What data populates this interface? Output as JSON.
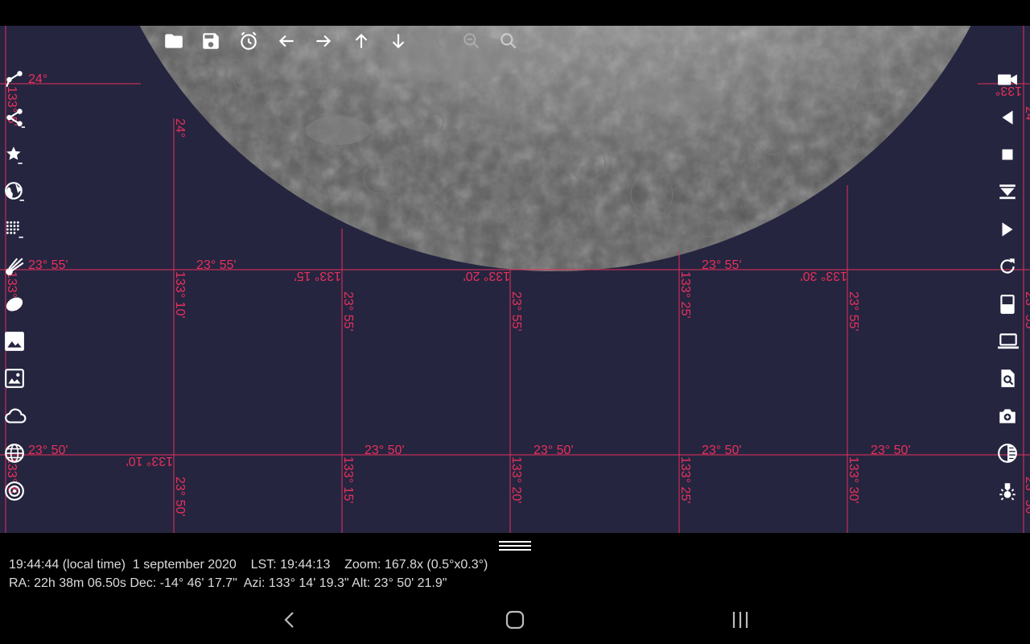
{
  "grid_labels": {
    "dec_24": "24°",
    "dec_2355": "23° 55'",
    "dec_2350": "23° 50'",
    "dec_2355_vertical": "23° 55'",
    "dec_2350_vertical": "23° 50'",
    "azi_13310": "133° 10'",
    "azi_13315": "133° 15'",
    "azi_13320": "133° 20'",
    "azi_13325": "133° 25'",
    "azi_13330": "133° 30'",
    "azi_edge": "133°",
    "azi_edge_v": "133° 5'"
  },
  "top_toolbar": [
    {
      "icon": "folder-icon",
      "label": "Open"
    },
    {
      "icon": "save-icon",
      "label": "Save"
    },
    {
      "icon": "alarm-clock-icon",
      "label": "Time"
    },
    {
      "icon": "arrow-left-icon",
      "label": "Left"
    },
    {
      "icon": "arrow-right-icon",
      "label": "Right"
    },
    {
      "icon": "arrow-up-icon",
      "label": "Up"
    },
    {
      "icon": "arrow-down-icon",
      "label": "Down"
    },
    {
      "icon": "zoom-in-icon",
      "label": "Zoom in"
    },
    {
      "icon": "zoom-out-icon",
      "label": "Zoom out"
    },
    {
      "icon": "zoom-icon",
      "label": "Zoom"
    }
  ],
  "left_toolbar": [
    "share-constellation-lines-icon",
    "share-constellation-icon",
    "star-icon",
    "globe-grid-icon",
    "dots-grid-icon",
    "comet-icon",
    "asteroid-icon",
    "image-icon",
    "image-frame-icon",
    "cloud-icon",
    "world-icon",
    "target-icon"
  ],
  "right_toolbar": [
    "video-camera-icon",
    "play-reverse-icon",
    "stop-icon",
    "step-down-icon",
    "play-icon",
    "refresh-icon",
    "split-view-icon",
    "laptop-icon",
    "search-document-icon",
    "camera-icon",
    "contrast-icon",
    "brightness-icon"
  ],
  "info": {
    "line1": "19:44:44 (local time)  1 september 2020    LST: 19:44:13    Zoom: 167.8x (0.5°x0.3°)",
    "line2": "RA: 22h 38m 06.50s Dec: -14° 46' 17.7\"  Azi: 133° 14' 19.3\" Alt: 23° 50' 21.9\""
  },
  "nav": {
    "back": "back-icon",
    "home": "home-icon",
    "recents": "recents-icon"
  },
  "colors": {
    "sky": "#252540",
    "grid": "#e8305a",
    "text": "#dcdcdc"
  }
}
